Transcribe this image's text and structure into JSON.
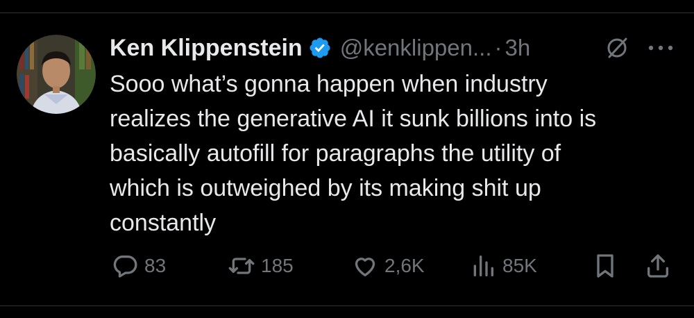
{
  "tweet": {
    "author": {
      "name": "Ken Klippenstein",
      "handle": "@kenklippen...",
      "verified": true
    },
    "time": "3h",
    "separator": "·",
    "text": "Sooo what’s gonna happen when industry\nrealizes the generative AI it sunk billions into is\nbasically autofill for paragraphs the utility of\nwhich is outweighed by its making shit up\nconstantly",
    "stats": {
      "replies": "83",
      "reposts": "185",
      "likes": "2,6K",
      "views": "85K"
    }
  },
  "colors": {
    "background": "#000000",
    "text": "#e7e9ea",
    "muted": "#71767b",
    "verified": "#1d9bf0",
    "divider": "#2f3336"
  },
  "icons": {
    "verified": "verified-badge-icon",
    "grok": "grok-icon",
    "more": "more-dots-icon",
    "reply": "reply-bubble-icon",
    "repost": "repost-arrows-icon",
    "like": "heart-icon",
    "views": "views-bars-icon",
    "bookmark": "bookmark-icon",
    "share": "share-upload-icon"
  }
}
